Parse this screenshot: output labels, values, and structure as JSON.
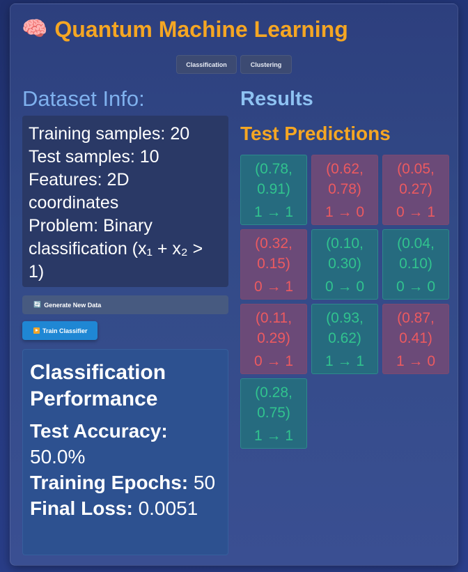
{
  "app": {
    "title_icon": "brain-icon",
    "title": "Quantum Machine Learning"
  },
  "tabs": [
    {
      "label": "Classification"
    },
    {
      "label": "Clustering"
    }
  ],
  "dataset": {
    "heading": "Dataset Info:",
    "lines": [
      "Training samples: 20",
      "Test samples: 10",
      "Features: 2D coordinates",
      "Problem: Binary classification (x₁ + x₂ > 1)"
    ]
  },
  "actions": {
    "generate_label": "Generate New Data",
    "generate_icon": "refresh-icon",
    "train_label": "Train Classifier",
    "train_icon": "play-icon"
  },
  "performance": {
    "title": "Classification Performance",
    "accuracy_label": "Test Accuracy:",
    "accuracy_value": "50.0%",
    "epochs_label": "Training Epochs:",
    "epochs_value": "50",
    "loss_label": "Final Loss:",
    "loss_value": "0.0051"
  },
  "results": {
    "heading": "Results",
    "predictions_heading": "Test Predictions",
    "predictions": [
      {
        "coords": "(0.78, 0.91)",
        "result": "1 → 1",
        "correct": true
      },
      {
        "coords": "(0.62, 0.78)",
        "result": "1 → 0",
        "correct": false
      },
      {
        "coords": "(0.05, 0.27)",
        "result": "0 → 1",
        "correct": false
      },
      {
        "coords": "(0.32, 0.15)",
        "result": "0 → 1",
        "correct": false
      },
      {
        "coords": "(0.10, 0.30)",
        "result": "0 → 0",
        "correct": true
      },
      {
        "coords": "(0.04, 0.10)",
        "result": "0 → 0",
        "correct": true
      },
      {
        "coords": "(0.11, 0.29)",
        "result": "0 → 1",
        "correct": false
      },
      {
        "coords": "(0.93, 0.62)",
        "result": "1 → 1",
        "correct": true
      },
      {
        "coords": "(0.87, 0.41)",
        "result": "1 → 0",
        "correct": false
      },
      {
        "coords": "(0.28, 0.75)",
        "result": "1 → 1",
        "correct": true
      }
    ]
  },
  "colors": {
    "accent": "#f5a623",
    "heading_blue": "#7fb1ee",
    "correct": "#31c38e",
    "wrong": "#ec5a60"
  }
}
